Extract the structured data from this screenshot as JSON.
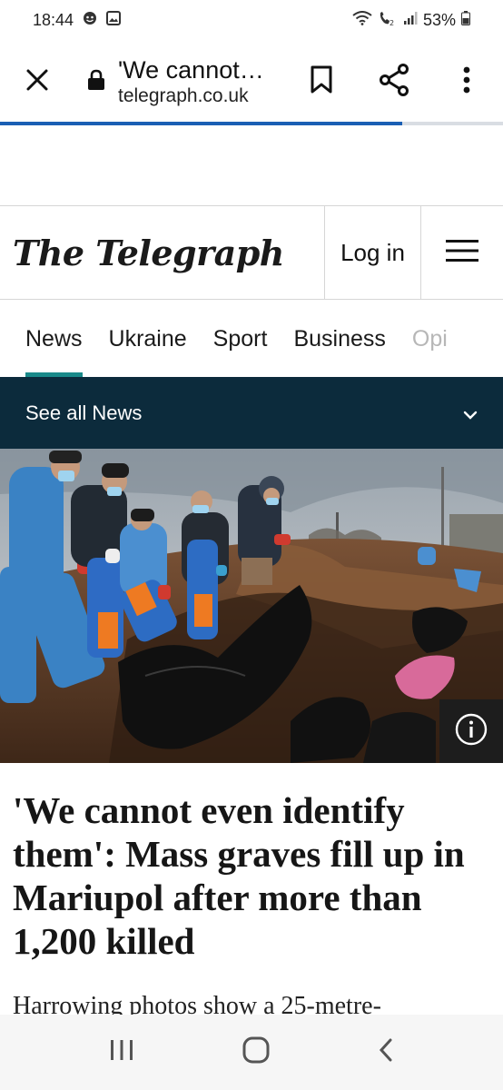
{
  "status_bar": {
    "time": "18:44",
    "battery": "53%",
    "icons": [
      "notification-dot-icon",
      "image-icon",
      "wifi-icon",
      "volte-icon",
      "signal-icon",
      "battery-icon"
    ]
  },
  "browser": {
    "page_title": "'We cannot…",
    "domain": "telegraph.co.uk",
    "load_progress": 0.8,
    "icons": [
      "close-icon",
      "lock-icon",
      "bookmark-icon",
      "share-icon",
      "more-vert-icon"
    ]
  },
  "site": {
    "logo_text": "The Telegraph",
    "login_label": "Log in"
  },
  "nav": {
    "items": [
      "News",
      "Ukraine",
      "Sport",
      "Business",
      "Opi"
    ],
    "active": "News"
  },
  "subnav": {
    "label": "See all News"
  },
  "article": {
    "headline": "'We cannot even identify them': Mass graves fill up in Mariupol after more than 1,200 killed",
    "standfirst": "Harrowing photos show a 25-metre-"
  },
  "colors": {
    "accent_teal": "#1a8a8a",
    "navy_bar": "#0c2b3c",
    "progress_blue": "#1a5fb4"
  }
}
